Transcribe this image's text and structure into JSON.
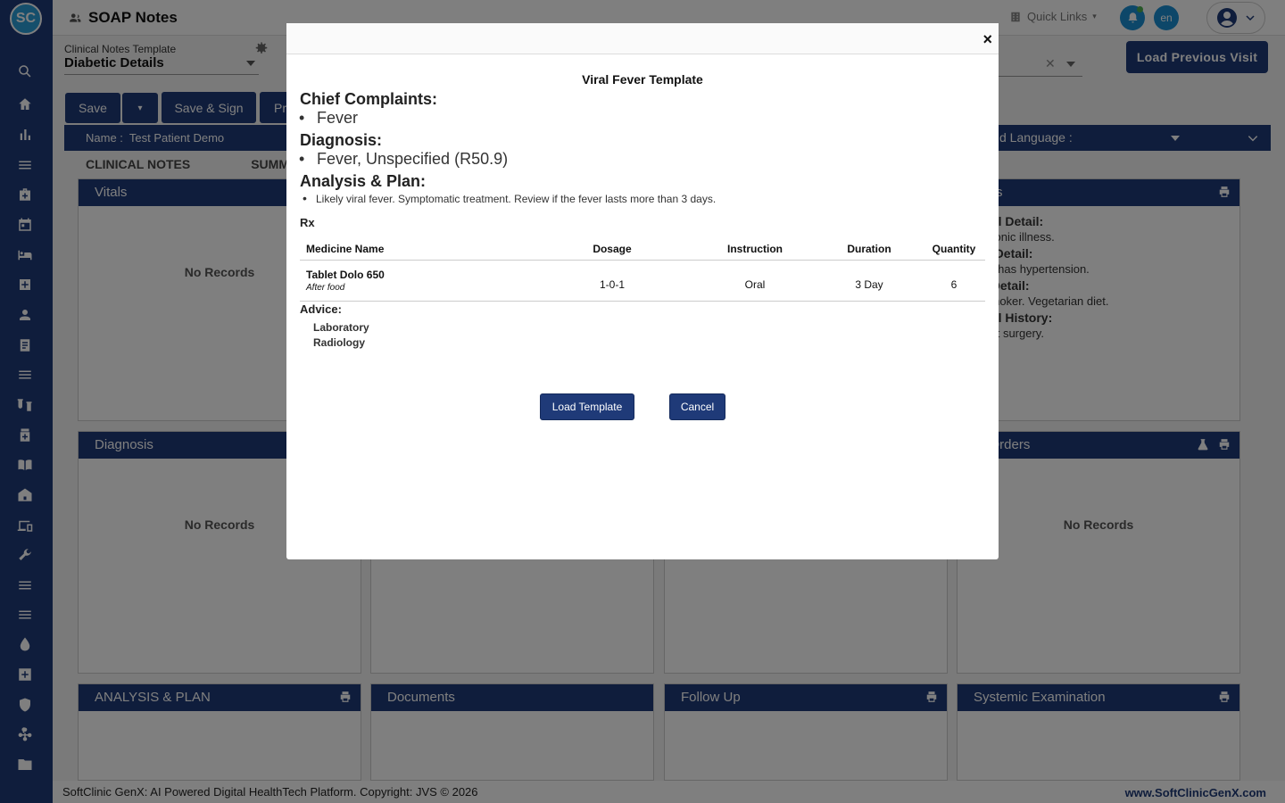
{
  "app": {
    "logo_text": "SC",
    "title": "SOAP Notes"
  },
  "topbar": {
    "quick_links": "Quick Links",
    "lang": "en"
  },
  "template_picker": {
    "label": "Clinical Notes Template",
    "value": "Diabetic Details"
  },
  "toolbar": {
    "save": "Save",
    "save_sign": "Save & Sign",
    "print_partial": "Pr",
    "load_previous": "Load Previous Visit"
  },
  "patient": {
    "name_label": "Name :",
    "name": "Test Patient Demo",
    "language_label": "d Language :"
  },
  "tabs": [
    "CLINICAL NOTES",
    "SUMM"
  ],
  "cards": {
    "vitals": {
      "title": "Vitals",
      "empty": "No Records"
    },
    "histories": {
      "title": "ories",
      "items": [
        {
          "head": "cal Detail:",
          "text": "hronic illness."
        },
        {
          "head": "y Detail:",
          "text": "er has hypertension."
        },
        {
          "head": "l Detail:",
          "text": "smoker. Vegetarian diet."
        },
        {
          "head": "cal History:",
          "text": "ast surgery."
        }
      ]
    },
    "diagnosis": {
      "title": "Diagnosis",
      "empty": "No Records"
    },
    "orders": {
      "title": "er Orders",
      "empty": "No Records"
    },
    "analysis": {
      "title": "ANALYSIS & PLAN"
    },
    "documents": {
      "title": "Documents"
    },
    "followup": {
      "title": "Follow Up"
    },
    "systemic": {
      "title": "Systemic Examination"
    }
  },
  "footer": {
    "left": "SoftClinic GenX: AI Powered Digital HealthTech Platform. Copyright: JVS © 2026",
    "right": "www.SoftClinicGenX.com"
  },
  "modal": {
    "close": "×",
    "title": "Viral Fever Template",
    "chief_complaints_head": "Chief Complaints:",
    "chief_complaints": [
      "Fever"
    ],
    "diagnosis_head": "Diagnosis:",
    "diagnosis": [
      "Fever, Unspecified (R50.9)"
    ],
    "plan_head": "Analysis & Plan:",
    "plan": [
      "Likely viral fever. Symptomatic treatment. Review if the fever lasts more than 3 days."
    ],
    "rx_label": "Rx",
    "rx_columns": {
      "name": "Medicine Name",
      "dosage": "Dosage",
      "instruction": "Instruction",
      "duration": "Duration",
      "quantity": "Quantity"
    },
    "rx_rows": [
      {
        "name": "Tablet Dolo 650",
        "note": "After food",
        "dosage": "1-0-1",
        "instruction": "Oral",
        "duration": "3 Day",
        "quantity": "6"
      }
    ],
    "advice_head": "Advice:",
    "advice": [
      "Laboratory",
      "Radiology"
    ],
    "load_button": "Load Template",
    "cancel_button": "Cancel"
  }
}
